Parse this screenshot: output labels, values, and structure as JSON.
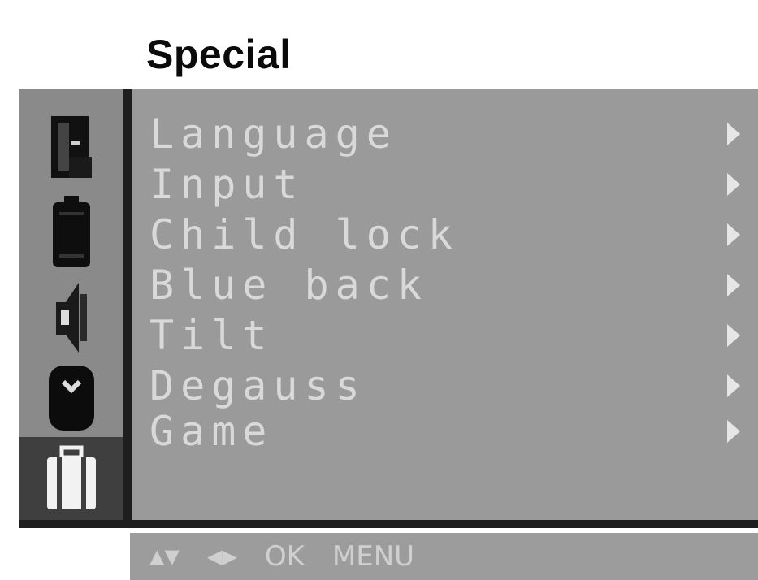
{
  "header": {
    "title": "Special"
  },
  "sidebar": {
    "icons": [
      {
        "name": "picture-mode-icon",
        "selected": false
      },
      {
        "name": "battery-icon",
        "selected": false
      },
      {
        "name": "audio-icon",
        "selected": false
      },
      {
        "name": "screen-icon",
        "selected": false
      },
      {
        "name": "special-suitcase-icon",
        "selected": true
      }
    ]
  },
  "menu": {
    "items": [
      {
        "label": "Language"
      },
      {
        "label": "Input"
      },
      {
        "label": "Child lock"
      },
      {
        "label": "Blue back"
      },
      {
        "label": "Tilt"
      },
      {
        "label": "Degauss"
      },
      {
        "label": "Game"
      }
    ]
  },
  "help": {
    "updown": "▲▼",
    "leftright": "◀▶",
    "ok": "OK",
    "menu": "MENU"
  },
  "colors": {
    "panel": "#9a9a9a",
    "rail": "#8a8a8a",
    "selected_slot": "#3f3f3f",
    "text": "#d9d9d9"
  }
}
